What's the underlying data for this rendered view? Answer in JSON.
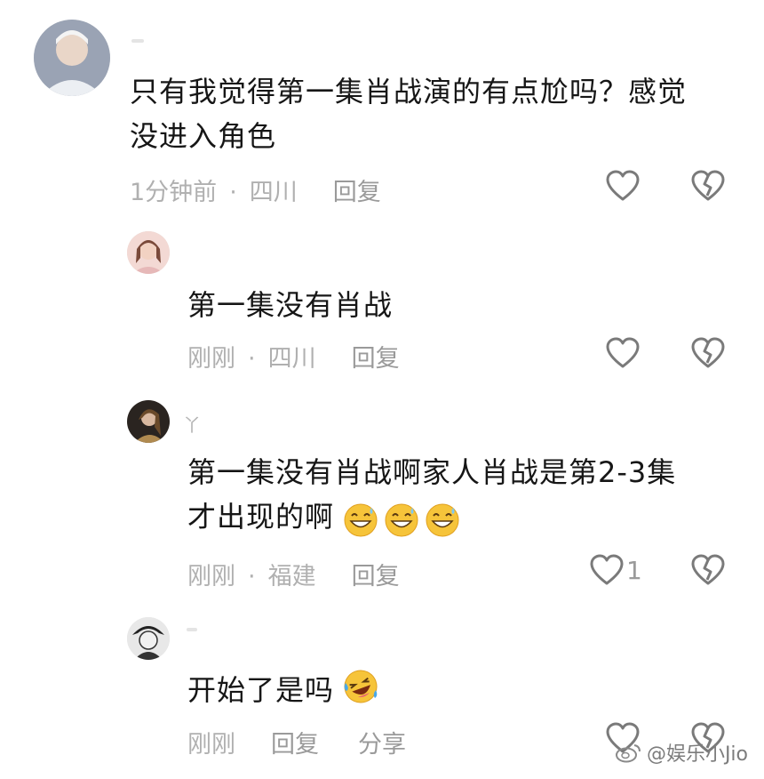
{
  "comments": [
    {
      "text": "只有我觉得第一集肖战演的有点尬吗？感觉\n没进入角色",
      "time": "1分钟前",
      "location": "四川",
      "reply": "回复"
    },
    {
      "text": "第一集没有肖战",
      "time": "刚刚",
      "location": "四川",
      "reply": "回复"
    },
    {
      "username": "丫",
      "text": "第一集没有肖战啊家人肖战是第2-3集\n才出现的啊",
      "time": "刚刚",
      "location": "福建",
      "reply": "回复",
      "like_count": "1"
    },
    {
      "text": "开始了是吗",
      "time": "刚刚",
      "reply": "回复",
      "share": "分享"
    }
  ],
  "watermark": "@娱乐小Jio",
  "icons": {
    "like": "heart-outline-icon",
    "dislike": "broken-heart-icon",
    "grin_emoji": "grinning-sweat-emoji",
    "laugh_emoji": "rofl-emoji",
    "weibo": "weibo-logo-icon"
  },
  "colors": {
    "text": "#161616",
    "meta": "#b0b0b0",
    "icon": "#7a7a7a"
  }
}
